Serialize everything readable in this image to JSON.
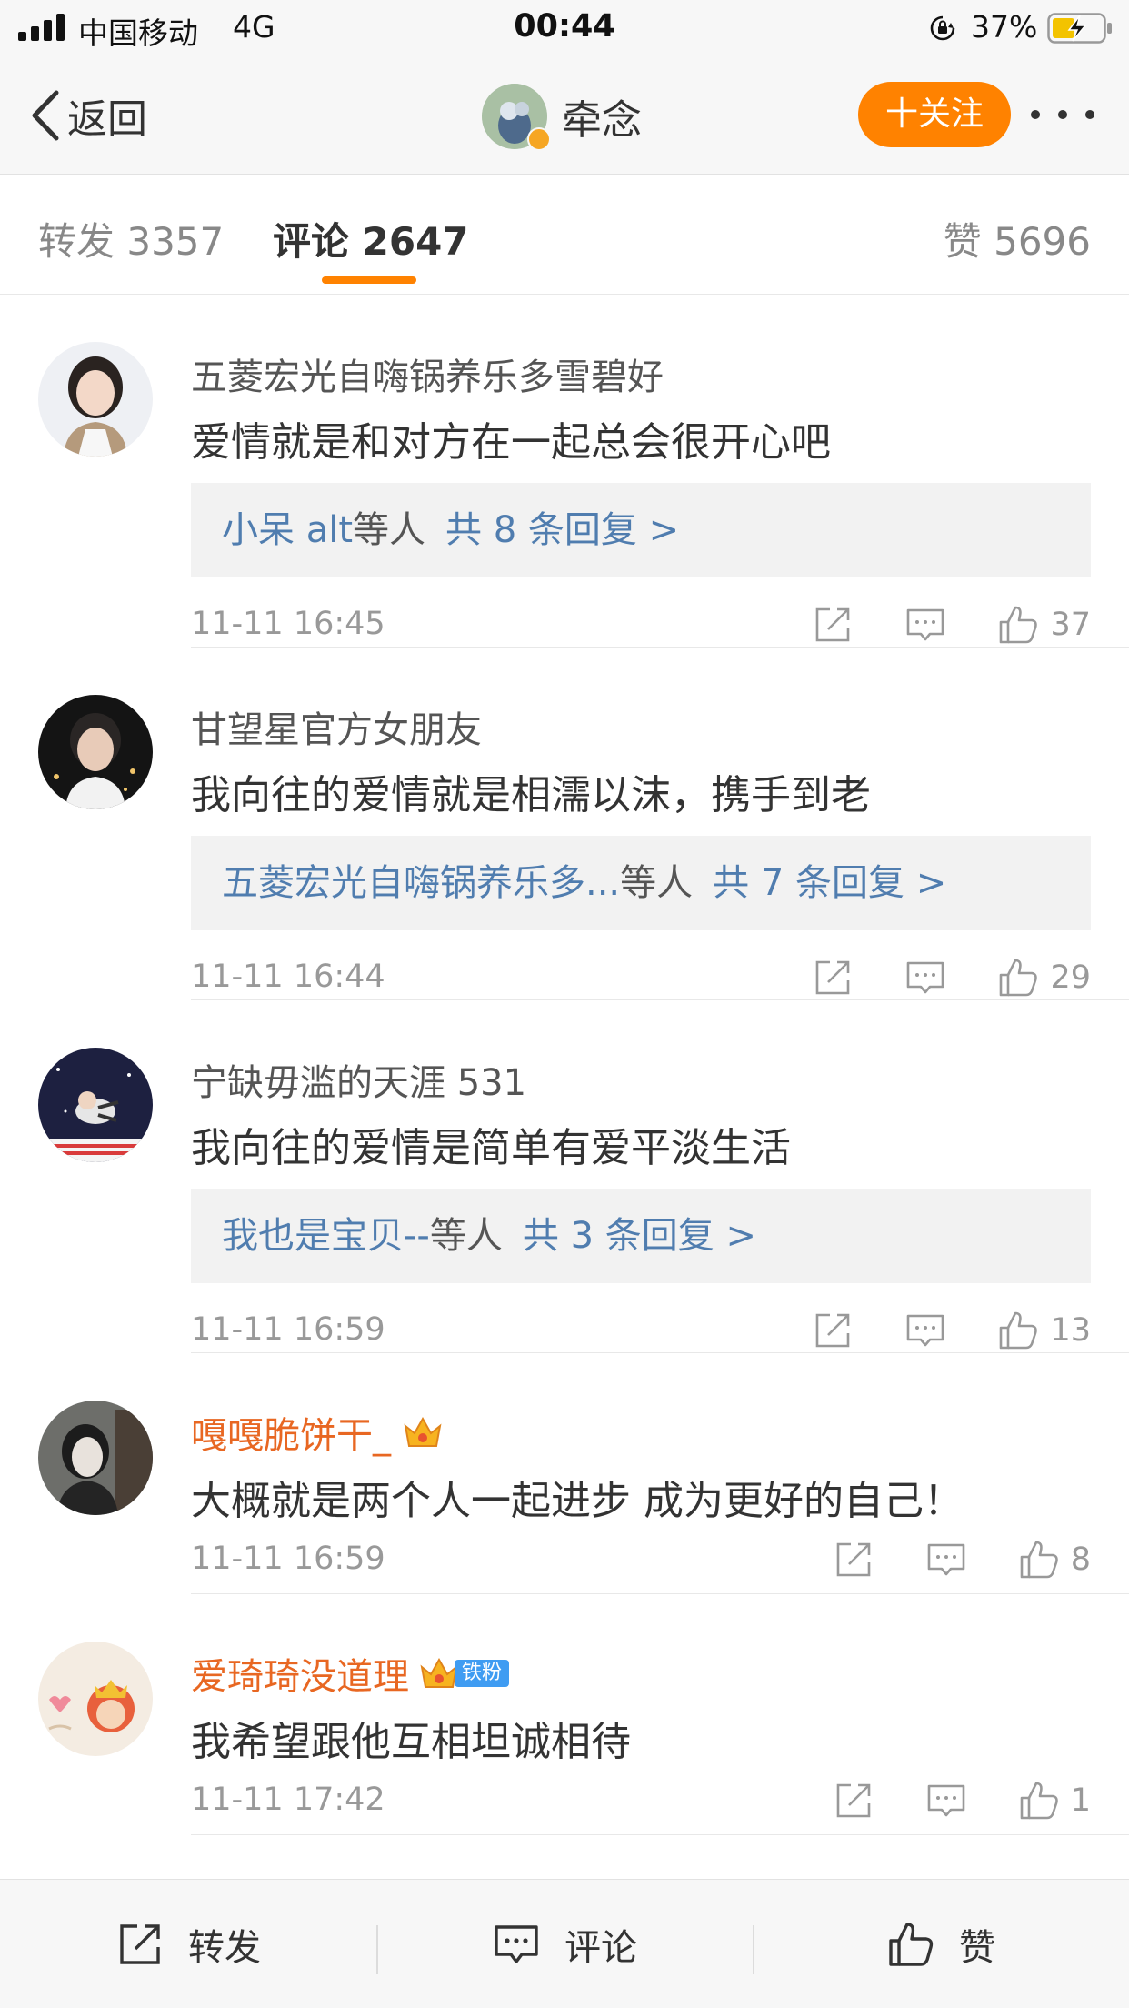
{
  "status_bar": {
    "carrier": "中国移动",
    "network": "4G",
    "time": "00:44",
    "battery": "37%"
  },
  "nav": {
    "back_label": "返回",
    "title": "牵念",
    "follow_label": "十关注"
  },
  "tabs": {
    "repost": "转发 3357",
    "comment": "评论 2647",
    "like": "赞 5696"
  },
  "comments": [
    {
      "username": "五菱宏光自嗨锅养乐多雪碧好",
      "text": "爱情就是和对方在一起总会很开心吧",
      "reply_names": "小呆 alt",
      "reply_etc": "等人",
      "reply_count": "共 8 条回复 >",
      "time": "11-11 16:45",
      "likes": "37"
    },
    {
      "username": "甘望星官方女朋友",
      "text": "我向往的爱情就是相濡以沫，携手到老",
      "reply_names": "五菱宏光自嗨锅养乐多...",
      "reply_etc": "等人",
      "reply_count": "共 7 条回复 >",
      "time": "11-11 16:44",
      "likes": "29"
    },
    {
      "username": "宁缺毋滥的天涯 531",
      "text": "我向往的爱情是简单有爱平淡生活",
      "reply_names": "我也是宝贝--",
      "reply_etc": "等人",
      "reply_count": "共 3 条回复 >",
      "time": "11-11 16:59",
      "likes": "13"
    },
    {
      "username": "嘎嘎脆饼干_",
      "text": "大概就是两个人一起进步 成为更好的自己！",
      "time": "11-11 16:59",
      "likes": "8"
    },
    {
      "username": "爱琦琦没道理",
      "badge": "铁粉",
      "text": "我希望跟他互相坦诚相待",
      "time": "11-11 17:42",
      "likes": "1"
    }
  ],
  "bottom_bar": {
    "repost": "转发",
    "comment": "评论",
    "like": "赞"
  },
  "colors": {
    "accent": "#ff8200",
    "link": "#507daf",
    "vip_name": "#e86722"
  },
  "icons": [
    "signal-icon",
    "lock-rotation-icon",
    "battery-charging-icon",
    "back-chevron-icon",
    "share-icon",
    "reply-icon",
    "thumb-up-icon",
    "crown-icon"
  ]
}
